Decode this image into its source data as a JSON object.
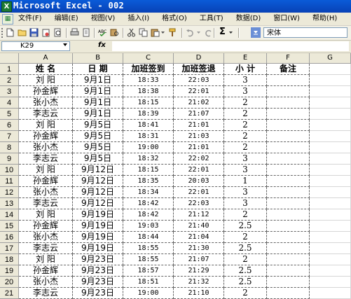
{
  "window": {
    "title": "Microsoft Excel - 002",
    "app_icon_glyph": "X"
  },
  "menu": [
    "文件(F)",
    "编辑(E)",
    "视图(V)",
    "插入(I)",
    "格式(O)",
    "工具(T)",
    "数据(D)",
    "窗口(W)",
    "帮助(H)"
  ],
  "toolbar": {
    "icons": [
      "new-icon",
      "open-icon",
      "save-icon",
      "permission-icon",
      "print-preview-icon",
      "print-icon",
      "spelling-icon",
      "research-icon",
      "cut-icon",
      "copy-icon",
      "paste-icon",
      "format-painter-icon",
      "undo-icon",
      "autosum-icon"
    ],
    "autosum_label": "Σ",
    "font_name": "宋体"
  },
  "formula_bar": {
    "name_box": "K29",
    "fx_label": "fx",
    "formula": ""
  },
  "sheet": {
    "columns": [
      "A",
      "B",
      "C",
      "D",
      "E",
      "F",
      "G"
    ],
    "header_row": {
      "row": "1",
      "cells": [
        "姓 名",
        "日 期",
        "加班签到",
        "加班签退",
        "小 计",
        "备注",
        ""
      ]
    },
    "rows": [
      {
        "row": "2",
        "name": "刘  阳",
        "date": "9月1日",
        "in": "18:33",
        "out": "22:03",
        "sub": "3"
      },
      {
        "row": "3",
        "name": "孙金辉",
        "date": "9月1日",
        "in": "18:38",
        "out": "22:01",
        "sub": "3"
      },
      {
        "row": "4",
        "name": "张小杰",
        "date": "9月1日",
        "in": "18:15",
        "out": "21:02",
        "sub": "2"
      },
      {
        "row": "5",
        "name": "李志云",
        "date": "9月1日",
        "in": "18:39",
        "out": "21:07",
        "sub": "2"
      },
      {
        "row": "6",
        "name": "刘  阳",
        "date": "9月5日",
        "in": "18:41",
        "out": "21:01",
        "sub": "2"
      },
      {
        "row": "7",
        "name": "孙金辉",
        "date": "9月5日",
        "in": "18:31",
        "out": "21:03",
        "sub": "2"
      },
      {
        "row": "8",
        "name": "张小杰",
        "date": "9月5日",
        "in": "19:00",
        "out": "21:01",
        "sub": "2"
      },
      {
        "row": "9",
        "name": "李志云",
        "date": "9月5日",
        "in": "18:32",
        "out": "22:02",
        "sub": "3"
      },
      {
        "row": "10",
        "name": "刘  阳",
        "date": "9月12日",
        "in": "18:15",
        "out": "22:01",
        "sub": "3"
      },
      {
        "row": "11",
        "name": "孙金辉",
        "date": "9月12日",
        "in": "18:35",
        "out": "20:03",
        "sub": "1"
      },
      {
        "row": "12",
        "name": "张小杰",
        "date": "9月12日",
        "in": "18:34",
        "out": "22:01",
        "sub": "3"
      },
      {
        "row": "13",
        "name": "李志云",
        "date": "9月12日",
        "in": "18:42",
        "out": "22:03",
        "sub": "3"
      },
      {
        "row": "14",
        "name": "刘  阳",
        "date": "9月19日",
        "in": "18:42",
        "out": "21:12",
        "sub": "2"
      },
      {
        "row": "15",
        "name": "孙金辉",
        "date": "9月19日",
        "in": "19:03",
        "out": "21:40",
        "sub": "2.5"
      },
      {
        "row": "16",
        "name": "张小杰",
        "date": "9月19日",
        "in": "18:44",
        "out": "21:04",
        "sub": "2"
      },
      {
        "row": "17",
        "name": "李志云",
        "date": "9月19日",
        "in": "18:55",
        "out": "21:30",
        "sub": "2.5"
      },
      {
        "row": "18",
        "name": "刘  阳",
        "date": "9月23日",
        "in": "18:55",
        "out": "21:07",
        "sub": "2"
      },
      {
        "row": "19",
        "name": "孙金辉",
        "date": "9月23日",
        "in": "18:57",
        "out": "21:29",
        "sub": "2.5"
      },
      {
        "row": "20",
        "name": "张小杰",
        "date": "9月23日",
        "in": "18:51",
        "out": "21:32",
        "sub": "2.5"
      },
      {
        "row": "21",
        "name": "李志云",
        "date": "9月23日",
        "in": "19:00",
        "out": "21:10",
        "sub": "2"
      }
    ]
  },
  "colors": {
    "title_bar": "#0a5bd8",
    "chrome": "#ece9d8",
    "header_bg": "#ece9d8",
    "grid_border": "#666666"
  }
}
